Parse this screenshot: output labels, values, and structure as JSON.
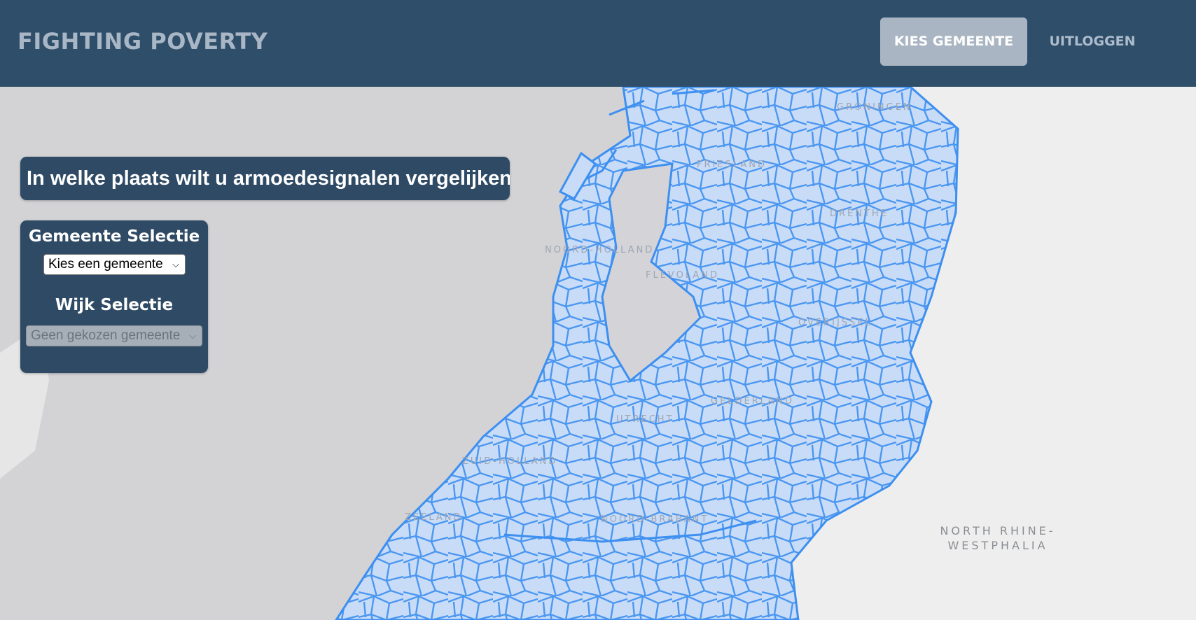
{
  "header": {
    "brand": "FIGHTING POVERTY",
    "nav": {
      "kies_gemeente": "KIES GEMEENTE",
      "uitloggen": "UITLOGGEN"
    }
  },
  "map": {
    "regions": [
      "GRONINGEN",
      "FRIESLAND",
      "DRENTHE",
      "NOORD-HOLLAND",
      "FLEVOLAND",
      "OVERIJSSEL",
      "GELDERLAND",
      "UTRECHT",
      "ZUID-HOLLAND",
      "ZEELAND",
      "NOORD-BRABANT"
    ],
    "nrw_label": "NORTH RHINE-WESTPHALIA",
    "colors": {
      "municipality_fill": "#c9dcf7",
      "municipality_stroke": "#3d8ff0",
      "water": "#d4d4d8",
      "land": "#eeeeee"
    }
  },
  "question": "In welke plaats wilt u armoedesignalen vergelijken?",
  "panel": {
    "gemeente_title": "Gemeente Selectie",
    "gemeente_select": "Kies een gemeente",
    "wijk_title": "Wijk Selectie",
    "wijk_select": "Geen gekozen gemeente"
  }
}
